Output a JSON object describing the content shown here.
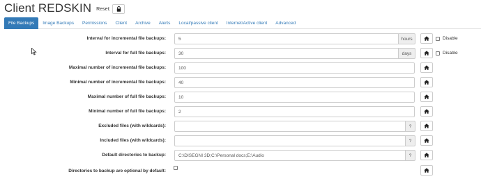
{
  "header": {
    "title": "Client REDSKIN",
    "reset_label": "Reset:"
  },
  "tabs": [
    {
      "label": "File Backups",
      "active": true
    },
    {
      "label": "Image Backups",
      "active": false
    },
    {
      "label": "Permissions",
      "active": false
    },
    {
      "label": "Client",
      "active": false
    },
    {
      "label": "Archive",
      "active": false
    },
    {
      "label": "Alerts",
      "active": false
    },
    {
      "label": "Local/passive client",
      "active": false
    },
    {
      "label": "Internet/Active client",
      "active": false
    },
    {
      "label": "Advanced",
      "active": false
    }
  ],
  "settings": {
    "incr_interval": {
      "label": "Interval for incremental file backups:",
      "value": "5",
      "unit": "hours",
      "disable_label": "Disable"
    },
    "full_interval": {
      "label": "Interval for full file backups:",
      "value": "30",
      "unit": "days",
      "disable_label": "Disable"
    },
    "max_incr": {
      "label": "Maximal number of incremental file backups:",
      "value": "100"
    },
    "min_incr": {
      "label": "Minimal number of incremental file backups:",
      "value": "40"
    },
    "max_full": {
      "label": "Maximal number of full file backups:",
      "value": "10"
    },
    "min_full": {
      "label": "Minimal number of full file backups:",
      "value": "2"
    },
    "excluded": {
      "label": "Excluded files (with wildcards):",
      "value": "",
      "help": "?"
    },
    "included": {
      "label": "Included files (with wildcards):",
      "value": "",
      "help": "?"
    },
    "default_dirs": {
      "label": "Default directories to backup:",
      "value": "C:\\DISEGNI 3D;C:\\Personal docs;E:\\Audio",
      "help": "?"
    },
    "dirs_optional": {
      "label": "Directories to backup are optional by default:",
      "checked": false
    }
  },
  "colors": {
    "accent": "#337ab7",
    "tab_active_text": "#ffffff",
    "addon_bg": "#eeeeee",
    "border": "#cccccc"
  },
  "icons": {
    "reset": "lock-icon",
    "row_reset": "home-icon",
    "cursor": "mouse-pointer-icon"
  }
}
